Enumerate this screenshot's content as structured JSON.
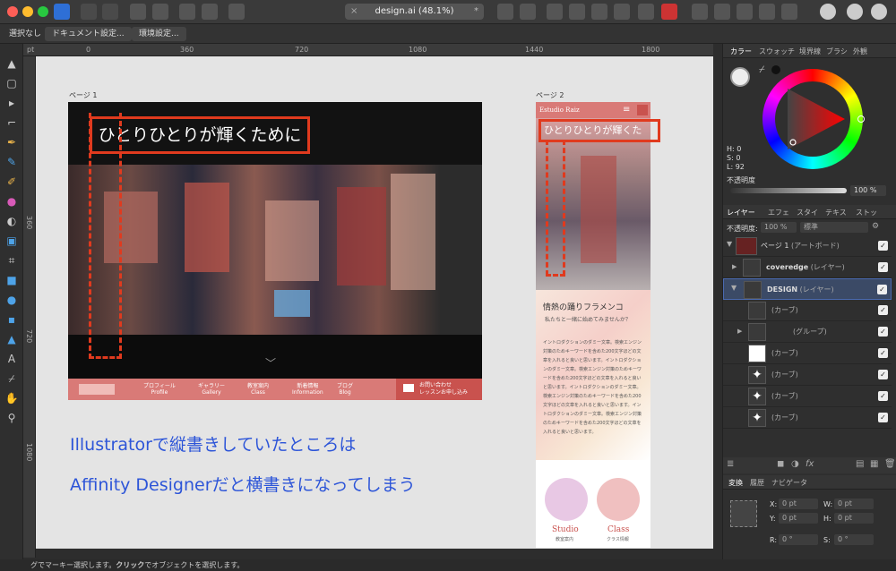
{
  "window": {
    "doc_tab": "design.ai (48.1%)",
    "colors": {
      "close": "#fe5f57",
      "minimize": "#febc2e",
      "zoom": "#28c840",
      "accent_red": "#e03a1e",
      "caption_blue": "#2d55d8"
    }
  },
  "context_toolbar": {
    "no_selection": "選択なし",
    "document_settings": "ドキュメント設定...",
    "preferences": "環境設定..."
  },
  "rulers": {
    "unit": "pt",
    "marks": [
      "0",
      "360",
      "720",
      "1080",
      "1440",
      "1800"
    ],
    "vmarks": [
      "360",
      "720",
      "1080"
    ]
  },
  "page1": {
    "label": "ページ 1",
    "headline": "ひとりひとりが輝くために",
    "nav": [
      {
        "jp": "プロフィール",
        "en": "Profile"
      },
      {
        "jp": "ギャラリー",
        "en": "Gallery"
      },
      {
        "jp": "教室案内",
        "en": "Class"
      },
      {
        "jp": "新着情報",
        "en": "Information"
      },
      {
        "jp": "ブログ",
        "en": "Blog"
      }
    ],
    "contact_line1": "お問い合わせ",
    "contact_line2": "レッスンお申し込み"
  },
  "page2": {
    "label": "ページ 2",
    "brand": "Estudio Raiz",
    "headline": "ひとりひとりが輝くた",
    "section_title": "情熱の踊りフラメンコ",
    "section_sub": "私たちと一緒に始めてみませんか？",
    "body": "イントロダクションのダミー文章。検索エンジン対策のためキーワードを含めた200文字ほどの文章を入れると良いと思います。イントロダクションのダミー文章。検索エンジン対策のためキーワードを含めた200文字ほどの文章を入れると良いと思います。イントロダクションのダミー文章。検索エンジン対策のためキーワードを含めた200文字ほどの文章を入れると良いと思います。イントロダクションのダミー文章。検索エンジン対策のためキーワードを含めた200文字ほどの文章を入れると良いと思います。",
    "studio_en": "Studio",
    "studio_jp": "教室案内",
    "class_en": "Class",
    "class_jp": "クラス情報"
  },
  "captions": {
    "line1": "Illustratorで縦書きしていたところは",
    "line2": "Affinity Designerだと横書きになってしまう"
  },
  "color_panel": {
    "tabs": [
      "カラー",
      "スウォッチ",
      "境界線",
      "ブラシ",
      "外観"
    ],
    "h": "H: 0",
    "s": "S: 0",
    "l": "L: 92",
    "opacity_label": "不透明度",
    "opacity_value": "100 %"
  },
  "layers_panel": {
    "tabs": [
      "レイヤー",
      "エフェ",
      "スタイ",
      "テキス",
      "ストッ"
    ],
    "opacity_label": "不透明度:",
    "opacity_value": "100 %",
    "blend": "標準",
    "rows": [
      {
        "name": "ページ 1",
        "kind": "(アートボード)"
      },
      {
        "name": "coveredge",
        "kind": "(レイヤー)"
      },
      {
        "name": "DESIGN",
        "kind": "(レイヤー)"
      },
      {
        "name": "",
        "kind": "(カーブ)"
      },
      {
        "name": "",
        "kind": "(グループ)"
      },
      {
        "name": "",
        "kind": "(カーブ)"
      },
      {
        "name": "",
        "kind": "(カーブ)"
      },
      {
        "name": "",
        "kind": "(カーブ)"
      },
      {
        "name": "",
        "kind": "(カーブ)"
      }
    ]
  },
  "transform_panel": {
    "tabs": [
      "変換",
      "履歴",
      "ナビゲータ"
    ],
    "x": "0 pt",
    "y": "0 pt",
    "w": "0 pt",
    "h": "0 pt",
    "r": "0 °",
    "s": "0 °"
  },
  "status": {
    "hint_prefix": "グでマーキー選択します。",
    "click": "クリック",
    "hint_suffix": "でオブジェクトを選択します。"
  }
}
